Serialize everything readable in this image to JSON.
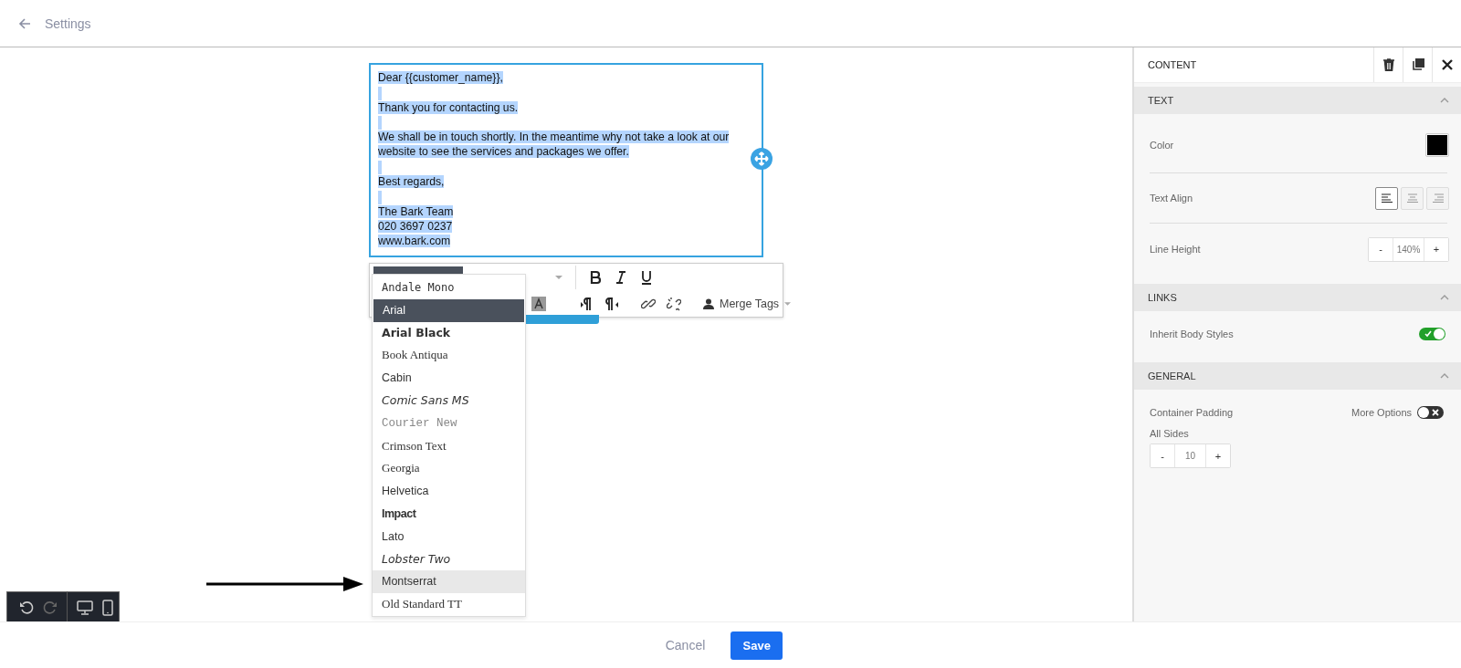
{
  "header": {
    "title": "Settings"
  },
  "editor": {
    "paragraphs": [
      {
        "selected": true,
        "lines": [
          "Dear {{customer_name}},"
        ]
      },
      {
        "selected": true,
        "lines": [
          "Thank you for contacting us."
        ]
      },
      {
        "selected": true,
        "lines": [
          "We shall be in touch shortly. In the meantime why not take a look at our",
          "website to see the services and packages we offer."
        ]
      },
      {
        "selected": true,
        "lines": [
          "Best regards,"
        ]
      },
      {
        "selected": true,
        "lines": [
          "The Bark Team",
          "020 3697 0237",
          "www.bark.com"
        ]
      }
    ]
  },
  "toolbar": {
    "merge_tags": "Merge Tags"
  },
  "font_menu": [
    {
      "label": "Andale Mono",
      "kind": "mono",
      "selected": false,
      "hovered": false
    },
    {
      "label": "Arial",
      "kind": "sans",
      "selected": true,
      "hovered": false
    },
    {
      "label": "Arial Black",
      "kind": "black",
      "selected": false,
      "hovered": false
    },
    {
      "label": "Book Antiqua",
      "kind": "serif",
      "selected": false,
      "hovered": false
    },
    {
      "label": "Cabin",
      "kind": "sans",
      "selected": false,
      "hovered": false
    },
    {
      "label": "Comic Sans MS",
      "kind": "script",
      "selected": false,
      "hovered": false
    },
    {
      "label": "Courier New",
      "kind": "courier",
      "selected": false,
      "hovered": false
    },
    {
      "label": "Crimson Text",
      "kind": "serif",
      "selected": false,
      "hovered": false
    },
    {
      "label": "Georgia",
      "kind": "serif",
      "selected": false,
      "hovered": false
    },
    {
      "label": "Helvetica",
      "kind": "sans",
      "selected": false,
      "hovered": false
    },
    {
      "label": "Impact",
      "kind": "impact",
      "selected": false,
      "hovered": false
    },
    {
      "label": "Lato",
      "kind": "sans",
      "selected": false,
      "hovered": false
    },
    {
      "label": "Lobster Two",
      "kind": "script",
      "selected": false,
      "hovered": false
    },
    {
      "label": "Montserrat",
      "kind": "sans",
      "selected": false,
      "hovered": true
    },
    {
      "label": "Old Standard TT",
      "kind": "serif",
      "selected": false,
      "hovered": false
    }
  ],
  "panel": {
    "title": "CONTENT",
    "sections": [
      {
        "title": "TEXT",
        "expanded": true,
        "rows": [
          {
            "kind": "color",
            "label": "Color",
            "color": "#000000"
          },
          {
            "kind": "align",
            "label": "Text Align",
            "options": [
              {
                "selected": true
              },
              {
                "selected": false
              },
              {
                "selected": false
              }
            ]
          },
          {
            "kind": "stepper",
            "label": "Line Height",
            "minus": "-",
            "value": "140%",
            "plus": "+"
          }
        ]
      },
      {
        "title": "LINKS",
        "expanded": true,
        "rows": [
          {
            "kind": "toggle",
            "label": "Inherit Body Styles",
            "on": true
          }
        ]
      },
      {
        "title": "GENERAL",
        "expanded": true,
        "rows": [
          {
            "kind": "padding",
            "label": "Container Padding",
            "option_label": "More Options",
            "on": false,
            "sub_label": "All Sides",
            "minus": "-",
            "value": "10",
            "plus": "+"
          }
        ]
      }
    ]
  },
  "footer": {
    "cancel": "Cancel",
    "save": "Save"
  }
}
